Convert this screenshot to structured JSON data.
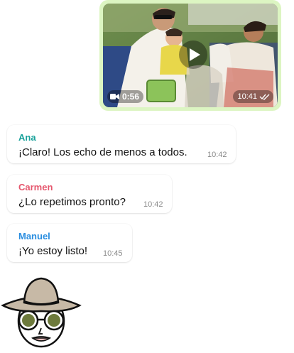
{
  "video_message": {
    "duration": "0:56",
    "time": "10:41",
    "status_icon": "double-check-icon"
  },
  "messages": [
    {
      "sender": "Ana",
      "sender_color": "#1aa29b",
      "text": "¡Claro! Los echo de menos a todos.",
      "time": "10:42"
    },
    {
      "sender": "Carmen",
      "sender_color": "#e5566d",
      "text": "¿Lo repetimos pronto?",
      "time": "10:42"
    },
    {
      "sender": "Manuel",
      "sender_color": "#2b8ee0",
      "text": "¡Yo estoy listo!",
      "time": "10:45"
    }
  ],
  "colors": {
    "outgoing_bubble": "#dcf5c2",
    "incoming_bubble": "#ffffff",
    "time_text": "#8a8a8a"
  },
  "sticker": {
    "icon": "sunhat-sunglasses-face-sticker"
  }
}
